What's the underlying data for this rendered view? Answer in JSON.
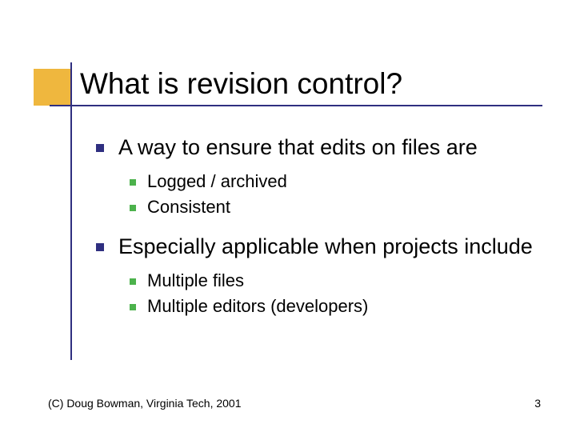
{
  "title": "What is revision control?",
  "bullets": {
    "b1": "A way to ensure that edits on files are",
    "b1_subs": {
      "s1": "Logged / archived",
      "s2": "Consistent"
    },
    "b2": "Especially applicable when projects include",
    "b2_subs": {
      "s1": "Multiple files",
      "s2": "Multiple editors (developers)"
    }
  },
  "footer": {
    "copyright": "(C) Doug Bowman, Virginia Tech, 2001",
    "page": "3"
  }
}
